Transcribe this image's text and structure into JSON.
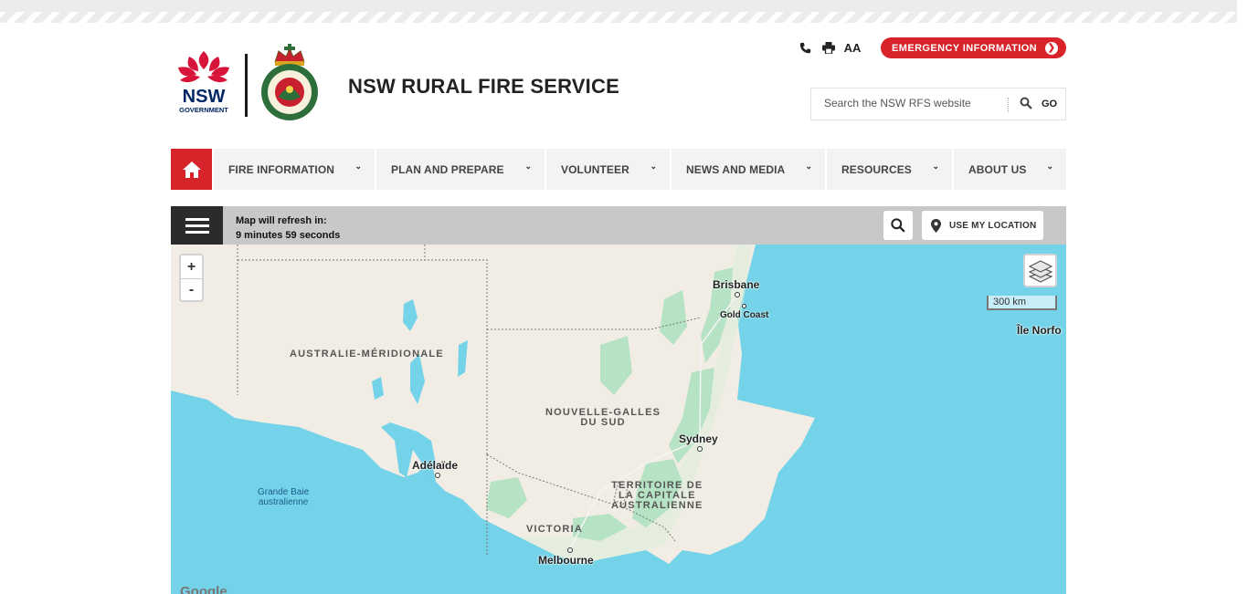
{
  "header": {
    "site_title": "NSW RURAL FIRE SERVICE",
    "nsw_logo_text": "NSW",
    "nsw_logo_sub": "GOVERNMENT",
    "emergency_label": "EMERGENCY INFORMATION",
    "text_size_label": "AA",
    "search": {
      "placeholder": "Search the NSW RFS website",
      "go_label": "GO"
    }
  },
  "nav": {
    "items": [
      {
        "label": "FIRE INFORMATION"
      },
      {
        "label": "PLAN AND PREPARE"
      },
      {
        "label": "VOLUNTEER"
      },
      {
        "label": "NEWS AND MEDIA"
      },
      {
        "label": "RESOURCES"
      },
      {
        "label": "ABOUT US"
      }
    ]
  },
  "map_toolbar": {
    "refresh_line1": "Map will refresh in:",
    "refresh_line2": "9 minutes 59 seconds",
    "locate_label": "USE MY LOCATION"
  },
  "map": {
    "zoom_in": "+",
    "zoom_out": "-",
    "scale_label": "300 km",
    "attribution": "Google",
    "labels": {
      "south_australia": "AUSTRALIE-MÉRIDIONALE",
      "nsw_line1": "NOUVELLE-GALLES",
      "nsw_line2": "DU SUD",
      "act_line1": "TERRITOIRE DE",
      "act_line2": "LA CAPITALE",
      "act_line3": "AUSTRALIENNE",
      "victoria": "VICTORIA",
      "bight_line1": "Grande Baie",
      "bight_line2": "australienne",
      "brisbane": "Brisbane",
      "gold_coast": "Gold Coast",
      "sydney": "Sydney",
      "adelaide": "Adélaïde",
      "melbourne": "Melbourne",
      "norfolk": "Île Norfo"
    }
  },
  "colors": {
    "brand_red": "#d8232a",
    "ocean": "#74d3e8",
    "land": "#f1ede4",
    "forest": "#b6e3c4"
  }
}
